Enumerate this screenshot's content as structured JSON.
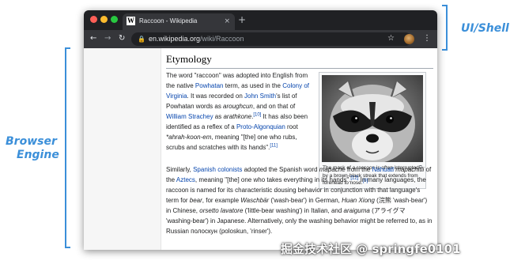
{
  "colors": {
    "annotation": "#3b8fd9",
    "titlebar": "#202124",
    "toolbar": "#35363a",
    "link": "#0645ad",
    "close_dot": "#ff5f57",
    "min_dot": "#febc2e",
    "max_dot": "#28c840"
  },
  "labels": {
    "ui_shell": "UI/Shell",
    "browser_engine_line1": "Browser",
    "browser_engine_line2": "Engine"
  },
  "browser": {
    "tab_favicon": "W",
    "tab_title": "Raccoon - Wikipedia",
    "tab_close_icon": "×",
    "new_tab_icon": "+",
    "back_icon": "←",
    "forward_icon": "→",
    "reload_icon": "↻",
    "lock_icon": "🔒",
    "url_host": "en.wikipedia.org",
    "url_path": "/wiki/Raccoon",
    "star_icon": "☆",
    "menu_icon": "⋮"
  },
  "article": {
    "heading": "Etymology",
    "p1": {
      "t1": "The word \"raccoon\" was adopted into English from the native ",
      "l1": "Powhatan",
      "t2": " term, as used in the ",
      "l2": "Colony of Virginia",
      "t3": ". It was recorded on ",
      "l3": "John Smith",
      "t4": "'s list of Powhatan words as ",
      "i1": "aroughcun",
      "t5": ", and on that of ",
      "l4": "William Strachey",
      "t6": " as ",
      "i2": "arathkone",
      "t7": ".",
      "s1": "[10]",
      "t8": " It has also been identified as a reflex of a ",
      "l5": "Proto-Algonquian",
      "t9": " root ",
      "i3": "*ahrah-koon-em",
      "t10": ", meaning \"[the] one who rubs, scrubs and scratches with its hands\".",
      "s2": "[11]"
    },
    "p2": {
      "t1": "Similarly, ",
      "l1": "Spanish colonists",
      "t2": " adopted the Spanish word ",
      "i1": "mapache",
      "t3": " from the ",
      "l2": "Nahuatl",
      "t4": " ",
      "i2": "mapachitli",
      "t5": " of the ",
      "l3": "Aztecs",
      "t6": ", meaning \"[the] one who takes everything in its hands\".",
      "s1": "[12]",
      "t7": " In many languages, the raccoon is named for its characteristic dousing behavior in conjunction with that language's term for ",
      "i3": "bear",
      "t8": ", for example ",
      "i4": "Waschbär",
      "t9": " ('wash-bear') in German, ",
      "i5": "Huan Xiong",
      "t10": " (浣熊 'wash-bear') in Chinese, ",
      "i6": "orsetto lavatore",
      "t11": " ('little-bear washing') in Italian, and ",
      "i7": "araiguma",
      "t12": " (アライグマ 'washing-bear') in Japanese. Alternatively, only the washing behavior might be referred to, as in Russian полоскун (poloskun, 'rinser')."
    },
    "caption": "The mask of a raccoon is often interrupted by a brown-black streak that extends from forehead to nose.",
    "caption_ref": "[9]",
    "magnify_icon": "⧉"
  },
  "watermark": "掘金技术社区 @ springfe0101"
}
